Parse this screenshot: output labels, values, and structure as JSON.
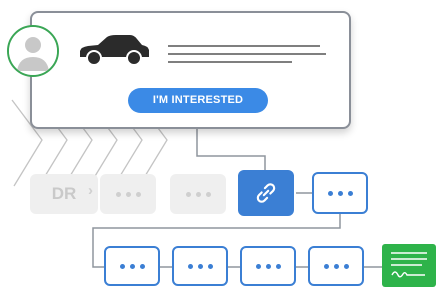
{
  "lead_card": {
    "cta_label": "I'M INTERESTED"
  },
  "stage_start": {
    "label": "DR",
    "arrow": "›"
  },
  "icons": {
    "avatar": "person-icon",
    "vehicle": "car-icon",
    "link": "link-icon",
    "document": "contract-document-icon"
  },
  "colors": {
    "accent_blue": "#3b7fd4",
    "button_blue": "#3b8ae6",
    "success_green": "#2eb34a",
    "avatar_ring": "#3aa655",
    "faded_box": "#efefef"
  },
  "flow": {
    "top_row": [
      "faded",
      "faded",
      "faded",
      "active",
      "outline"
    ],
    "bottom_row": [
      "outline",
      "outline",
      "outline",
      "outline",
      "document"
    ]
  }
}
